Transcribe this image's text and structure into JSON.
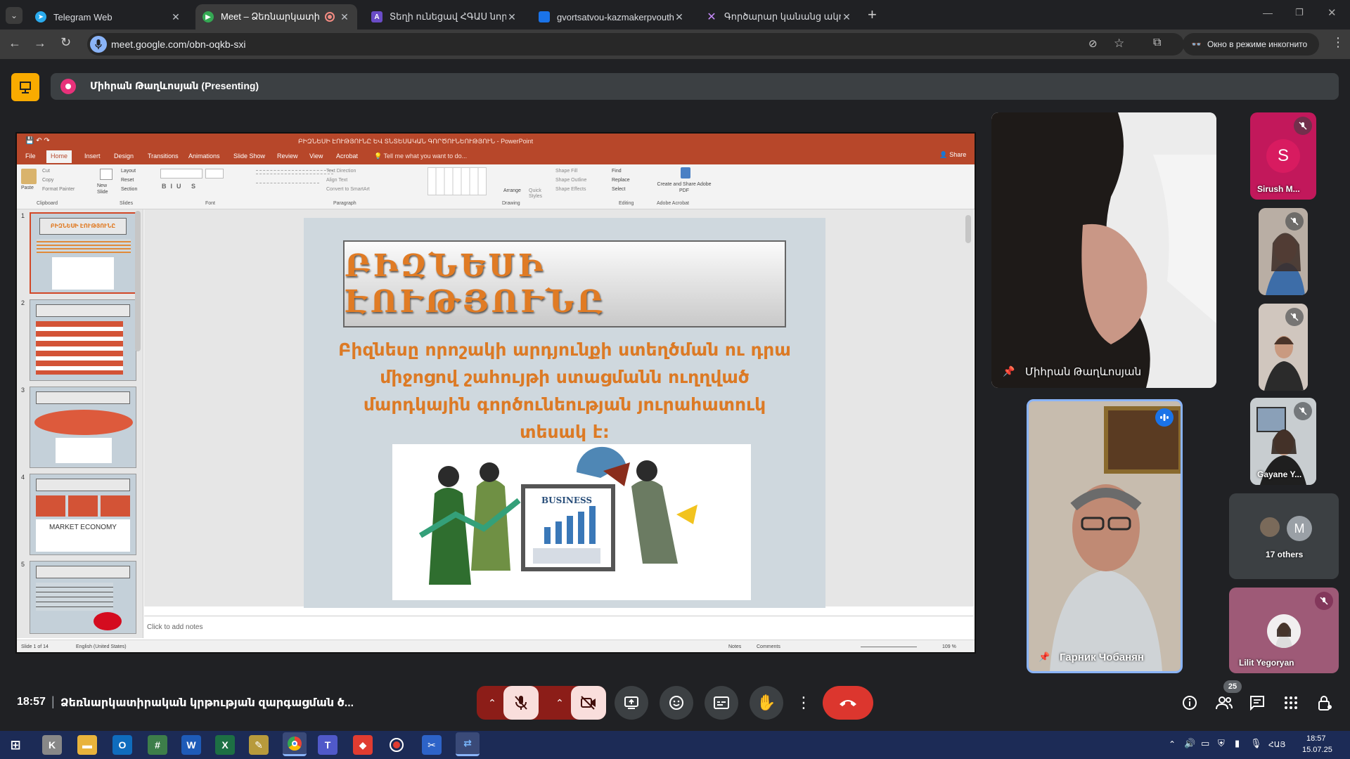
{
  "tabs": [
    {
      "title": "Telegram Web",
      "favicon": "telegram-icon",
      "active": false
    },
    {
      "title": "Meet – Ձեռնարկատիրակ",
      "favicon": "meet-icon",
      "active": true,
      "recording": true
    },
    {
      "title": "Տեղի ունեցավ ՀԳԱՍ նորից",
      "favicon": "app-icon",
      "active": false
    },
    {
      "title": "gvortsatvou-kazmakerpvouthy",
      "favicon": "slides-icon",
      "active": false
    },
    {
      "title": "Գործարար կանանց ակումբ",
      "favicon": "x-logo-icon",
      "active": false
    }
  ],
  "toolbar": {
    "url": "meet.google.com/obn-oqkb-sxi",
    "incognito_label": "Окно в режиме инкогнито"
  },
  "meet_header": {
    "presenter_label": "Միհրան Թաղևոսյան (Presenting)"
  },
  "powerpoint": {
    "window_title": "ԲԻԶՆԵՍԻ ԷՈՒԹՅՈՒՆԸ ԵՎ ՏՆՏԵՍԱԿԱՆ ԳՈՐԾՈՒՆԵՈՒԹՅՈՒՆ - PowerPoint",
    "share_label": "Share",
    "ribbon_tabs": [
      "File",
      "Home",
      "Insert",
      "Design",
      "Transitions",
      "Animations",
      "Slide Show",
      "Review",
      "View",
      "Acrobat"
    ],
    "tell_me": "Tell me what you want to do...",
    "groups": [
      "Clipboard",
      "Slides",
      "Font",
      "Paragraph",
      "Drawing",
      "Editing",
      "Adobe Acrobat"
    ],
    "commands": {
      "paste": "Paste",
      "cut": "Cut",
      "copy": "Copy",
      "format_painter": "Format Painter",
      "new_slide": "New Slide",
      "layout": "Layout",
      "reset": "Reset",
      "section": "Section",
      "text_direction": "Text Direction",
      "align_text": "Align Text",
      "convert_smartart": "Convert to SmartArt",
      "arrange": "Arrange",
      "quick_styles": "Quick Styles",
      "shape_fill": "Shape Fill",
      "shape_outline": "Shape Outline",
      "shape_effects": "Shape Effects",
      "find": "Find",
      "replace": "Replace",
      "select": "Select",
      "create_pdf": "Create and Share Adobe PDF"
    },
    "thumbnails": [
      {
        "num": "1",
        "caption": "ԲԻԶՆԵՍԻ ԷՈՒԹՅՈՒՆԸ"
      },
      {
        "num": "2",
        "caption": ""
      },
      {
        "num": "3",
        "caption": ""
      },
      {
        "num": "4",
        "caption": "MARKET ECONOMY"
      },
      {
        "num": "5",
        "caption": ""
      }
    ],
    "slide": {
      "title": "ԲԻԶՆԵՍԻ ԷՈՒԹՅՈՒՆԸ",
      "body_lines": [
        "Բիզնեսը որոշակի արդյունքի ստեղծման ու դրա",
        "միջոցով շահույթի ստացմանն ուղղված",
        "մարդկային գործունեության յուրահատուկ",
        "տեսակ է:"
      ],
      "image_label": "BUSINESS"
    },
    "notes_placeholder": "Click to add notes",
    "status": {
      "slide": "Slide 1 of 14",
      "language": "English (United States)",
      "notes": "Notes",
      "comments": "Comments",
      "zoom": "109 %"
    }
  },
  "participants": {
    "presenter_name": "Միհրան Թաղևոսյան",
    "speaker_name": "Гарник Чобанян",
    "side": [
      {
        "initial": "S",
        "name": "Sirush M...",
        "color": "#c2185b"
      },
      {
        "name": ""
      },
      {
        "name": ""
      },
      {
        "name": "Gayane Y..."
      },
      {
        "initial": "M",
        "name": "17 others"
      },
      {
        "name": "Lilit Yegoryan"
      }
    ]
  },
  "footer": {
    "time": "18:57",
    "meeting_title": "Ձեռնարկատիրական կրթության զարգացման ծ...",
    "participant_count": "25"
  },
  "taskbar": {
    "time": "18:57",
    "date": "15.07.25",
    "lang": "ՀԱՅ"
  }
}
